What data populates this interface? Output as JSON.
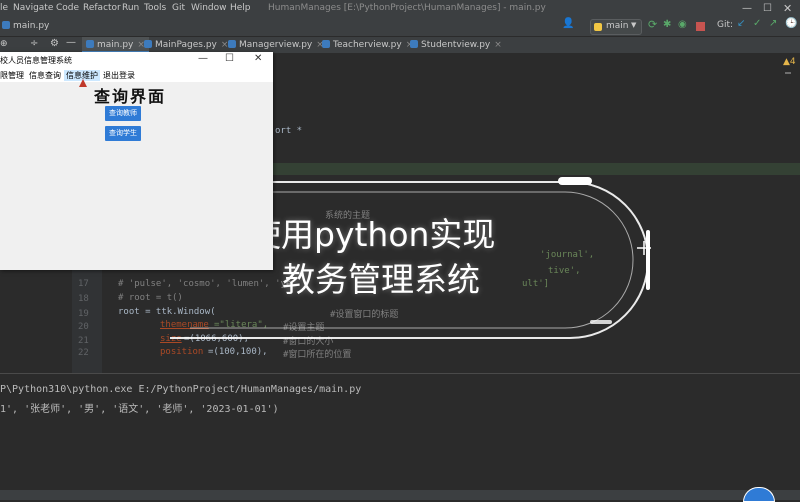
{
  "ide": {
    "menu": [
      "File",
      "Navigate",
      "Code",
      "Refactor",
      "Run",
      "Tools",
      "Git",
      "Window",
      "Help"
    ],
    "window_title": "HumanManages [E:\\PythonProject\\HumanManages] - main.py",
    "breadcrumb": "main.py",
    "branch": "main",
    "git_label": "Git:",
    "warning_count": "4",
    "tabs": [
      {
        "label": "main.py",
        "active": true
      },
      {
        "label": "MainPages.py",
        "active": false
      },
      {
        "label": "Managerview.py",
        "active": false
      },
      {
        "label": "Teacherview.py",
        "active": false
      },
      {
        "label": "Studentview.py",
        "active": false
      }
    ]
  },
  "editor": {
    "visible_fragments": {
      "import_tail": "ort *",
      "comment_theme": "系统的主题",
      "themes_line_tail": "'journal',",
      "themes_line2_tail": "tive',",
      "line18": "# 'pulse', 'cosmo', 'lumen', 'ye",
      "line18_tail": "ult']",
      "line19": "# root = t",
      "line19_tail": "()",
      "line20": "root = ttk.Window(",
      "line20_comment": "#设置窗口的标题",
      "line21_param": "themename",
      "line21_value": "=\"litera\",",
      "line21_comment": "#设置主题",
      "line22_param": "size",
      "line22_value": "=(1066,600),",
      "line22_comment": "#窗口的大小",
      "line23_param": "position",
      "line23_value": "=(100,100),",
      "line23_comment": "#窗口所在的位置"
    },
    "line_numbers": [
      "17",
      "18",
      "19",
      "20",
      "21",
      "22",
      "23"
    ]
  },
  "console": {
    "lines": [
      "P\\Python310\\python.exe E:/PythonProject/HumanManages/main.py",
      "1', '张老师', '男', '语文', '老师', '2023-01-01')"
    ]
  },
  "overlay": {
    "line1": "使用python实现",
    "line2": "教务管理系统"
  },
  "tk_window": {
    "title": "校人员信息管理系统",
    "controls": {
      "minimize": "—",
      "maximize": "☐",
      "close": "✕"
    },
    "menu": [
      "限管理",
      "信息查询",
      "信息维护",
      "退出登录"
    ],
    "heading": "查询界面",
    "buttons": [
      "查询教师",
      "查询学生"
    ]
  },
  "colors": {
    "ide_bg": "#2b2b2b",
    "ide_panel": "#3c3f41",
    "tk_button": "#2f7bd6",
    "overlay_text": "#ffffff"
  }
}
